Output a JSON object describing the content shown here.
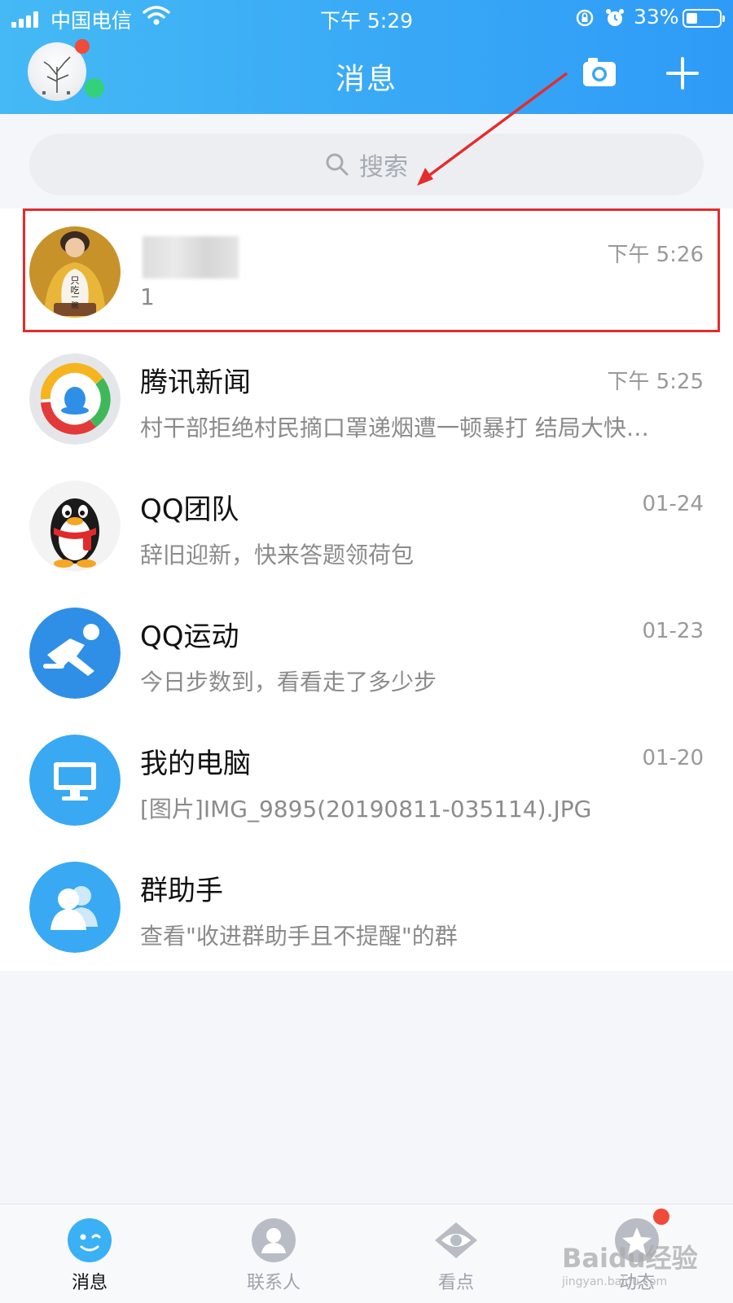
{
  "status_bar": {
    "carrier": "中国电信",
    "time": "下午 5:29",
    "battery": "33%"
  },
  "header": {
    "title": "消息"
  },
  "search": {
    "placeholder": "搜索"
  },
  "conversations": [
    {
      "name": "",
      "time": "下午 5:26",
      "preview": "1",
      "highlighted": true
    },
    {
      "name": "腾讯新闻",
      "time": "下午 5:25",
      "preview": "村干部拒绝村民摘口罩递烟遭一顿暴打 结局大快…"
    },
    {
      "name": "QQ团队",
      "time": "01-24",
      "preview": "辞旧迎新，快来答题领荷包"
    },
    {
      "name": "QQ运动",
      "time": "01-23",
      "preview": "今日步数到，看看走了多少步"
    },
    {
      "name": "我的电脑",
      "time": "01-20",
      "preview": "[图片]IMG_9895(20190811-035114).JPG"
    },
    {
      "name": "群助手",
      "time": "",
      "preview": "查看\"收进群助手且不提醒\"的群"
    }
  ],
  "avatar_sticker_text": [
    "只",
    "吃",
    "一",
    "碗"
  ],
  "tabbar": {
    "items": [
      {
        "label": "消息",
        "active": true
      },
      {
        "label": "联系人"
      },
      {
        "label": "看点"
      },
      {
        "label": "动态"
      }
    ]
  },
  "watermark": {
    "brand": "Baidu经验",
    "url": "jingyan.baidu.com"
  },
  "colors": {
    "header_gradient_start": "#45b9f5",
    "header_gradient_end": "#2e9bf7",
    "highlight_border": "#e52c2c",
    "badge_red": "#f04a3a",
    "online_green": "#33d17a",
    "qq_blue": "#3aa8f0"
  }
}
